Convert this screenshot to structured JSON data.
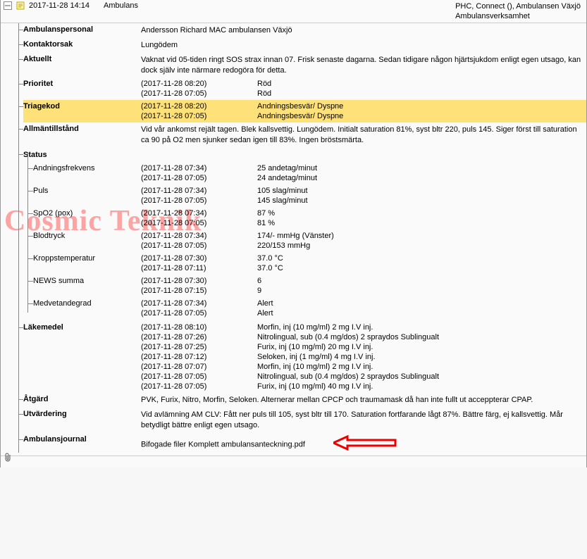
{
  "header": {
    "date_time": "2017-11-28  14:14",
    "title": "Ambulans",
    "right_line1": "PHC, Connect (), Ambulansen Växjö",
    "right_line2": "Ambulansverksamhet"
  },
  "rows": [
    {
      "key": "ambulanspersonal",
      "label": "Ambulanspersonal",
      "free": "Andersson Richard MAC ambulansen Växjö"
    },
    {
      "key": "kontaktorsak",
      "label": "Kontaktorsak",
      "free": "Lungödem"
    },
    {
      "key": "aktuellt",
      "label": "Aktuellt",
      "free": "Vaknat vid 05-tiden ringt SOS strax innan 07. Frisk senaste dagarna. Sedan tidigare någon hjärtsjukdom enligt egen utsago, kan dock själv inte närmare redogöra för detta."
    },
    {
      "key": "prioritet",
      "label": "Prioritet",
      "pairs": [
        {
          "ts": "(2017-11-28 08:20)",
          "val": "Röd"
        },
        {
          "ts": "(2017-11-28 07:05)",
          "val": "Röd"
        }
      ]
    },
    {
      "key": "triagekod",
      "label": "Triagekod",
      "highlight": true,
      "pairs": [
        {
          "ts": "(2017-11-28 08:20)",
          "val": "Andningsbesvär/ Dyspne"
        },
        {
          "ts": "(2017-11-28 07:05)",
          "val": "Andningsbesvär/ Dyspne"
        }
      ]
    },
    {
      "key": "allmantillstand",
      "label": "Allmäntillstånd",
      "free": "Vid vår ankomst rejält tagen. Blek kallsvettig. Lungödem. Initialt saturation 81%, syst bltr 220, puls 145. Siger först till saturation ca 90 på O2 men sjunker sedan igen till 83%. Ingen bröstsmärta."
    }
  ],
  "status_label": "Status",
  "status": [
    {
      "key": "andning",
      "label": "Andningsfrekvens",
      "pairs": [
        {
          "ts": "(2017-11-28 07:34)",
          "val": "25 andetag/minut"
        },
        {
          "ts": "(2017-11-28 07:05)",
          "val": "24 andetag/minut"
        }
      ]
    },
    {
      "key": "puls",
      "label": "Puls",
      "pairs": [
        {
          "ts": "(2017-11-28 07:34)",
          "val": "105 slag/minut"
        },
        {
          "ts": "(2017-11-28 07:05)",
          "val": "145 slag/minut"
        }
      ]
    },
    {
      "key": "spo2",
      "label": "SpO2 (pox)",
      "pairs": [
        {
          "ts": "(2017-11-28 07:34)",
          "val": "87 %"
        },
        {
          "ts": "(2017-11-28 07:05)",
          "val": "81 %"
        }
      ]
    },
    {
      "key": "blodtryck",
      "label": "Blodtryck",
      "pairs": [
        {
          "ts": "(2017-11-28 07:34)",
          "val": "174/- mmHg (Vänster)"
        },
        {
          "ts": "(2017-11-28 07:05)",
          "val": "220/153 mmHg"
        }
      ]
    },
    {
      "key": "temp",
      "label": "Kroppstemperatur",
      "pairs": [
        {
          "ts": "(2017-11-28 07:30)",
          "val": "37.0 °C"
        },
        {
          "ts": "(2017-11-28 07:11)",
          "val": "37.0 °C"
        }
      ]
    },
    {
      "key": "news",
      "label": "NEWS summa",
      "pairs": [
        {
          "ts": "(2017-11-28 07:30)",
          "val": "6"
        },
        {
          "ts": "(2017-11-28 07:15)",
          "val": "9"
        }
      ]
    },
    {
      "key": "medvet",
      "label": "Medvetandegrad",
      "pairs": [
        {
          "ts": "(2017-11-28 07:34)",
          "val": "Alert"
        },
        {
          "ts": "(2017-11-28 07:05)",
          "val": "Alert"
        }
      ]
    }
  ],
  "rows2": [
    {
      "key": "lakemedel",
      "label": "Läkemedel",
      "pairs": [
        {
          "ts": "(2017-11-28 08:10)",
          "val": "Morfin, inj (10 mg/ml) 2 mg I.V inj."
        },
        {
          "ts": "(2017-11-28 07:26)",
          "val": "Nitrolingual, sub (0.4 mg/dos) 2 spraydos Sublingualt"
        },
        {
          "ts": "(2017-11-28 07:25)",
          "val": "Furix, inj (10 mg/ml) 20 mg I.V inj."
        },
        {
          "ts": "(2017-11-28 07:12)",
          "val": "Seloken, inj (1 mg/ml) 4 mg I.V inj."
        },
        {
          "ts": "(2017-11-28 07:07)",
          "val": "Morfin, inj (10 mg/ml) 2 mg I.V inj."
        },
        {
          "ts": "(2017-11-28 07:05)",
          "val": "Nitrolingual, sub (0.4 mg/dos) 2 spraydos Sublingualt"
        },
        {
          "ts": "(2017-11-28 07:05)",
          "val": "Furix, inj (10 mg/ml) 40 mg I.V inj."
        }
      ]
    },
    {
      "key": "atgard",
      "label": "Åtgärd",
      "free": "PVK, Furix, Nitro, Morfin, Seloken. Alternerar mellan CPCP och traumamask då han inte fullt ut acceppterar CPAP."
    },
    {
      "key": "utvardering",
      "label": "Utvärdering",
      "free": "Vid avlämning AM CLV: Fått ner puls till 105, syst bltr till 170. Saturation fortfarande lågt 87%. Bättre färg, ej kallsvettig. Mår betydligt bättre enligt egen utsago."
    },
    {
      "key": "ambjournal",
      "label": "Ambulansjournal",
      "free": "Bifogade filer Komplett ambulansanteckning.pdf",
      "has_attachment": true,
      "has_arrow": true
    }
  ],
  "watermark": "Cosmic Teknik",
  "chart_data": {
    "type": "table",
    "title": "Status",
    "categories": [
      "Andningsfrekvens",
      "Puls",
      "SpO2 (pox)",
      "Blodtryck",
      "Kroppstemperatur",
      "NEWS summa",
      "Medvetandegrad"
    ],
    "series": [
      {
        "name": "2017-11-28 07:34",
        "values": [
          "25 andetag/minut",
          "105 slag/minut",
          "87 %",
          "174/- mmHg (Vänster)",
          null,
          null,
          "Alert"
        ]
      },
      {
        "name": "2017-11-28 07:30",
        "values": [
          null,
          null,
          null,
          null,
          "37.0 °C",
          "6",
          null
        ]
      },
      {
        "name": "2017-11-28 07:15",
        "values": [
          null,
          null,
          null,
          null,
          null,
          "9",
          null
        ]
      },
      {
        "name": "2017-11-28 07:11",
        "values": [
          null,
          null,
          null,
          null,
          "37.0 °C",
          null,
          null
        ]
      },
      {
        "name": "2017-11-28 07:05",
        "values": [
          "24 andetag/minut",
          "145 slag/minut",
          "81 %",
          "220/153 mmHg",
          null,
          null,
          "Alert"
        ]
      }
    ]
  }
}
